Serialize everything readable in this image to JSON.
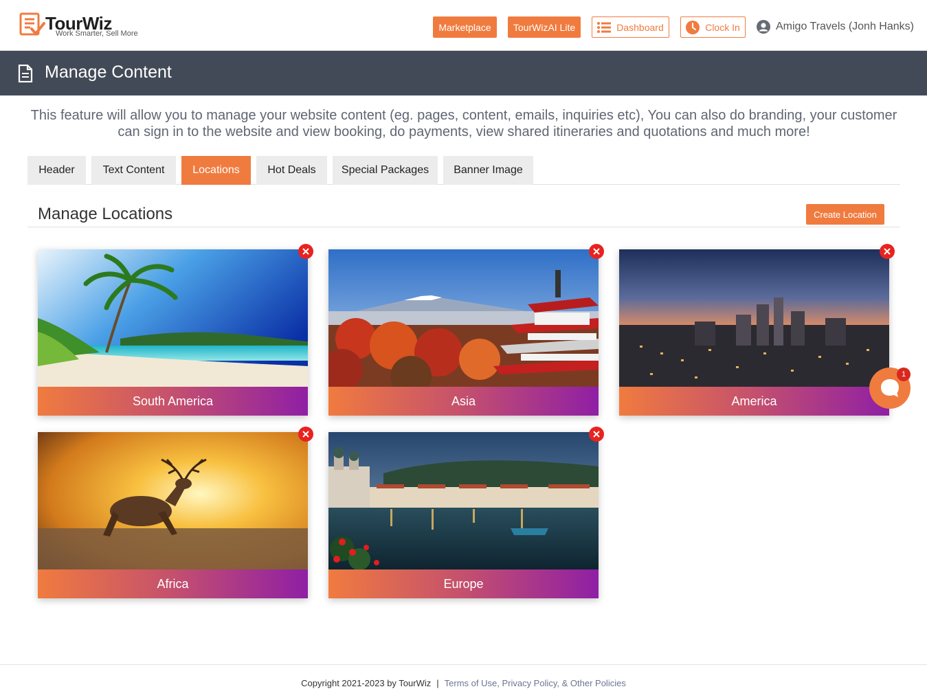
{
  "brand": {
    "name": "TourWiz",
    "tagline": "Work Smarter, Sell More",
    "accent_color": "#f07b3f"
  },
  "topnav": {
    "marketplace": "Marketplace",
    "lite": "TourWizAI Lite",
    "dashboard": "Dashboard",
    "clock_in": "Clock In",
    "user": "Amigo Travels (Jonh Hanks)"
  },
  "page": {
    "title": "Manage Content",
    "intro": "This feature will allow you to manage your website content (eg. pages, content, emails, inquiries etc), You can also do branding, your customer can sign in to the website and view booking, do payments, view shared itineraries and quotations and much more!"
  },
  "tabs": [
    {
      "label": "Header",
      "active": false
    },
    {
      "label": "Text Content",
      "active": false
    },
    {
      "label": "Locations",
      "active": true
    },
    {
      "label": "Hot Deals",
      "active": false
    },
    {
      "label": "Special Packages",
      "active": false
    },
    {
      "label": "Banner Image",
      "active": false
    }
  ],
  "locations": {
    "heading": "Manage Locations",
    "create_label": "Create Location",
    "items": [
      {
        "name": "South America",
        "image": "tropical-beach"
      },
      {
        "name": "Asia",
        "image": "pagoda-mount-fuji"
      },
      {
        "name": "America",
        "image": "city-skyline-dusk"
      },
      {
        "name": "Africa",
        "image": "deer-sunset"
      },
      {
        "name": "Europe",
        "image": "lake-town"
      }
    ]
  },
  "chat": {
    "badge": "1",
    "icon": "chat-icon"
  },
  "footer": {
    "copyright": "Copyright 2021-2023 by TourWiz",
    "separator": "|",
    "policies": "Terms of Use, Privacy Policy, & Other Policies"
  }
}
